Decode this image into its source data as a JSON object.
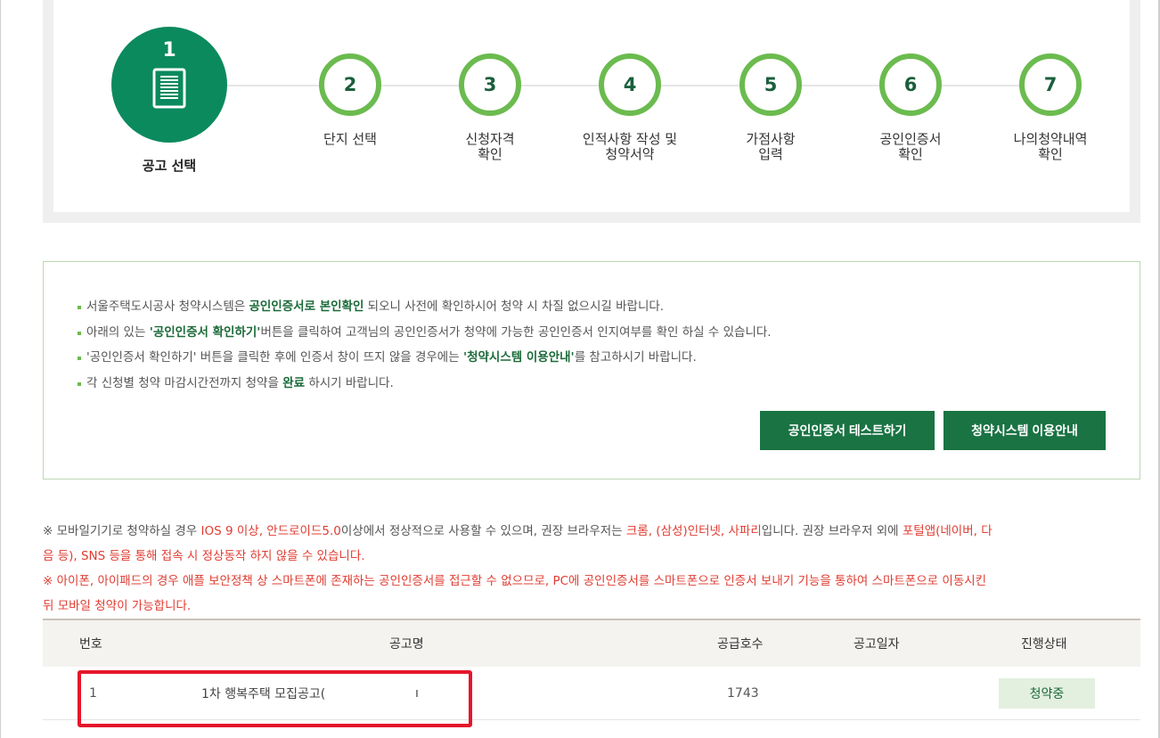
{
  "steps": [
    {
      "num": "1",
      "label": "공고 선택",
      "active": true
    },
    {
      "num": "2",
      "label": "단지 선택"
    },
    {
      "num": "3",
      "label1": "신청자격",
      "label2": "확인"
    },
    {
      "num": "4",
      "label1": "인적사항 작성 및",
      "label2": "청약서약"
    },
    {
      "num": "5",
      "label1": "가점사항",
      "label2": "입력"
    },
    {
      "num": "6",
      "label1": "공인인증서",
      "label2": "확인"
    },
    {
      "num": "7",
      "label1": "나의청약내역",
      "label2": "확인"
    }
  ],
  "notice": {
    "line1_a": "서울주택도시공사 청약시스템은 ",
    "line1_b": "공인인증서로 본인확인",
    "line1_c": " 되오니 사전에 확인하시어 청약 시 차질 없으시길 바랍니다.",
    "line2_a": "아래의 있는 ",
    "line2_b": "'공인인증서 확인하기'",
    "line2_c": "버튼을 클릭하여 고객님의 공인인증서가 청약에 가능한 공인인증서 인지여부를 확인 하실 수 있습니다.",
    "line3_a": "'공인인증서 확인하기' 버튼을 클릭한 후에 인증서 창이 뜨지 않을 경우에는  ",
    "line3_b": "'청약시스템 이용안내'",
    "line3_c": "를 참고하시기 바랍니다.",
    "line4_a": "각 신청별 청약 마감시간전까지 청약을 ",
    "line4_b": "완료",
    "line4_c": " 하시기 바랍니다.",
    "btn_test": "공인인증서 테스트하기",
    "btn_guide": "청약시스템 이용안내"
  },
  "mobile": {
    "p1_a": "※ 모바일기기로 청약하실 경우 ",
    "p1_b": "IOS 9 이상, 안드로이드5.0",
    "p1_c": "이상에서 정상적으로 사용할 수 있으며, 권장 브라우저는 ",
    "p1_d": "크롬, (삼성)인터넷, 사파리",
    "p1_e": "입니다. 권장 브라우저 외에 ",
    "p1_f": "포털앱(네이버, 다",
    "p1_g": "음 등), SNS 등을 통해 접속 시 정상동작 하지 않을 수 있습니다.",
    "p2_line1": "※ 아이폰, 아이패드의 경우 애플 보안정책 상 스마트폰에 존재하는 공인인증서를 접근할 수 없으므로, PC에 공인인증서를 스마트폰으로 인증서 보내기 기능을 통하여 스마트폰으로 이동시킨",
    "p2_line2": "뒤 모바일 청약이 가능합니다."
  },
  "table": {
    "headers": {
      "no": "번호",
      "title": "공고명",
      "units": "공급호수",
      "date": "공고일자",
      "status": "진행상태"
    },
    "rows": [
      {
        "no": "1",
        "title": "1차 행복주택 모집공고(",
        "title_tail": "ı",
        "units": "1743",
        "date": "",
        "status": "청약중"
      }
    ]
  },
  "colors": {
    "accent": "#0b8a5e",
    "ring": "#6bbb4f",
    "button": "#1a7343",
    "warning": "#e03c31",
    "highlight_box": "#e5162b"
  }
}
